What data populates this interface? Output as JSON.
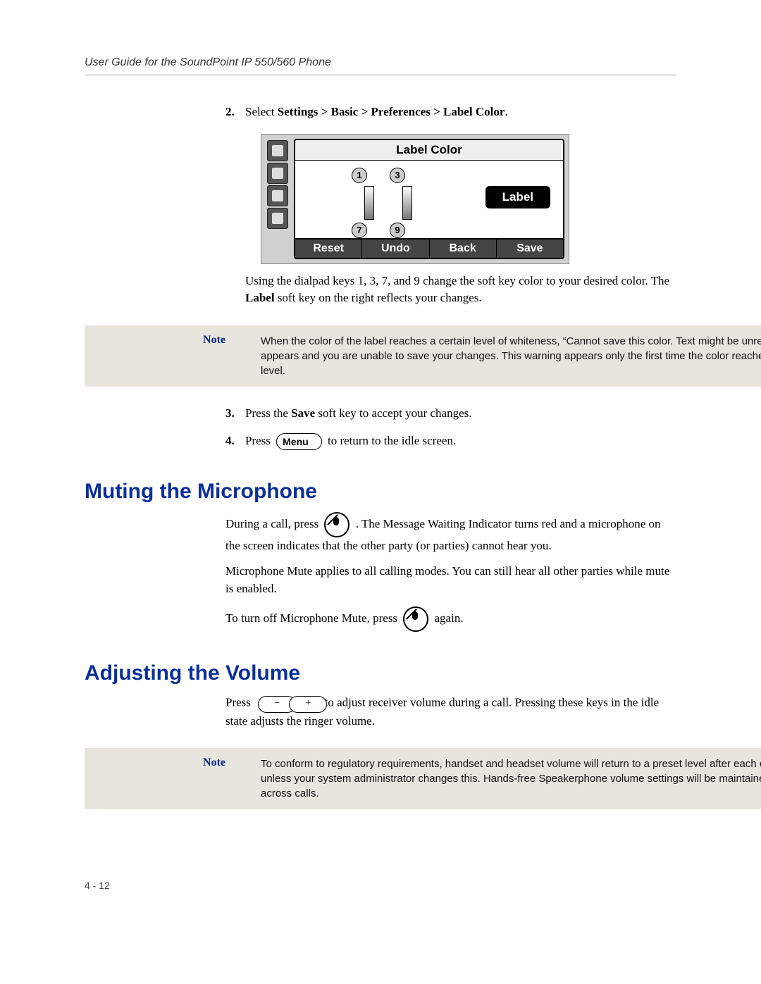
{
  "header": {
    "title": "User Guide for the SoundPoint IP 550/560 Phone"
  },
  "steps": {
    "s2": {
      "num": "2.",
      "prefix": "Select ",
      "bold": "Settings > Basic > Preferences > Label Color",
      "suffix": "."
    },
    "s3": {
      "num": "3.",
      "t1": "Press the ",
      "bold": "Save",
      "t2": " soft key to accept your changes."
    },
    "s4": {
      "num": "4.",
      "t1": "Press ",
      "btn": "Menu",
      "t2": " to return to the idle screen."
    }
  },
  "screen": {
    "title": "Label Color",
    "nums": {
      "tl": "1",
      "tr": "3",
      "bl": "7",
      "br": "9"
    },
    "label_btn": "Label",
    "softkeys": {
      "k1": "Reset",
      "k2": "Undo",
      "k3": "Back",
      "k4": "Save"
    }
  },
  "para_after_screen": {
    "t1": "Using the dialpad keys 1, 3, 7, and 9 change the soft key color to your desired color. The ",
    "bold": "Label",
    "t2": " soft key on the right reflects your changes."
  },
  "note1": {
    "label": "Note",
    "text": "When the color of the label reaches a certain level of whiteness, “Cannot save this color. Text might be unreadable.” appears and you are unable to save your changes. This warning appears only the first time the color reaches that level."
  },
  "section_mute": {
    "heading": "Muting the Microphone",
    "p1a": "During a call, press ",
    "p1b": ". The Message Waiting Indicator turns red and a microphone on the screen indicates that the other party (or parties) cannot hear you.",
    "p2": "Microphone Mute applies to all calling modes. You can still hear all other parties while mute is enabled.",
    "p3a": "To turn off Microphone Mute, press ",
    "p3b": " again."
  },
  "section_vol": {
    "heading": "Adjusting the Volume",
    "p1a": "Press ",
    "p1b": " to adjust receiver volume during a call. Pressing these keys in the idle state adjusts the ringer volume.",
    "minus": "−",
    "plus": "+"
  },
  "note2": {
    "label": "Note",
    "text": "To conform to regulatory requirements, handset and headset volume will return to a preset level after each call, unless your system administrator changes this. Hands-free Speakerphone volume settings will be maintained across calls."
  },
  "page_num": "4 - 12"
}
